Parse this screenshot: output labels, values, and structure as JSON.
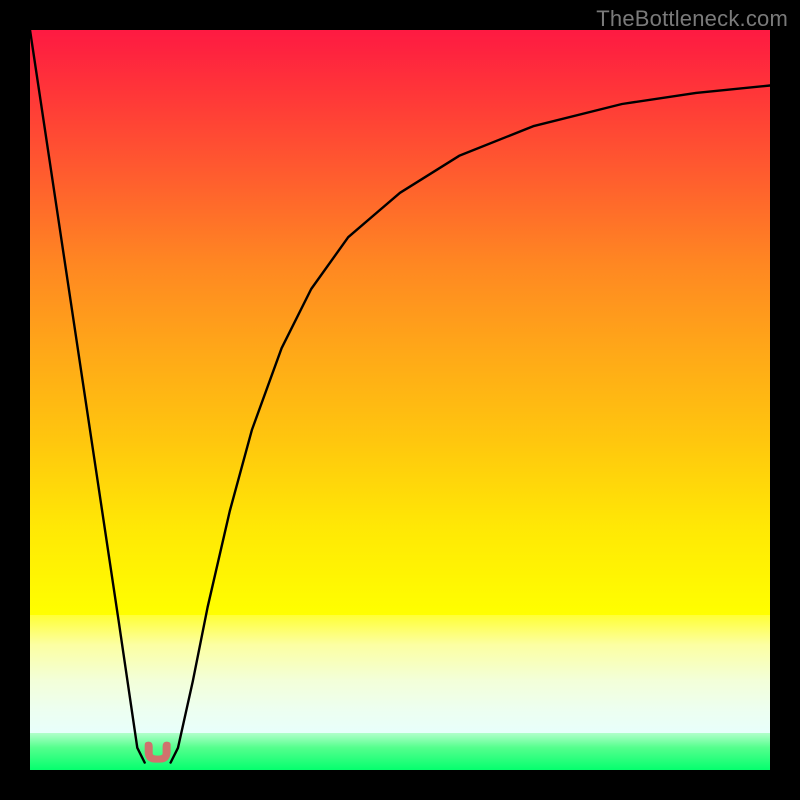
{
  "attribution": "TheBottleneck.com",
  "colors": {
    "frame": "#000000",
    "curve": "#000000",
    "marker_fill": "#d0726d",
    "marker_stroke": "#c15c57",
    "gradient_top": "#fe1a42",
    "gradient_mid": "#ffff00",
    "gradient_bottom": "#05ff6e"
  },
  "chart_data": {
    "type": "line",
    "title": "",
    "xlabel": "",
    "ylabel": "",
    "xlim": [
      0,
      100
    ],
    "ylim": [
      0,
      100
    ],
    "series": [
      {
        "name": "left-branch",
        "x": [
          0,
          3,
          6,
          9,
          12,
          14.5,
          15.5
        ],
        "y": [
          100,
          80,
          60,
          40,
          20,
          3,
          1
        ]
      },
      {
        "name": "right-branch",
        "x": [
          19,
          20,
          22,
          24,
          27,
          30,
          34,
          38,
          43,
          50,
          58,
          68,
          80,
          90,
          100
        ],
        "y": [
          1,
          3,
          12,
          22,
          35,
          46,
          57,
          65,
          72,
          78,
          83,
          87,
          90,
          91.5,
          92.5
        ]
      }
    ],
    "min_marker": {
      "x_range": [
        15.5,
        19
      ],
      "y": 1
    }
  }
}
